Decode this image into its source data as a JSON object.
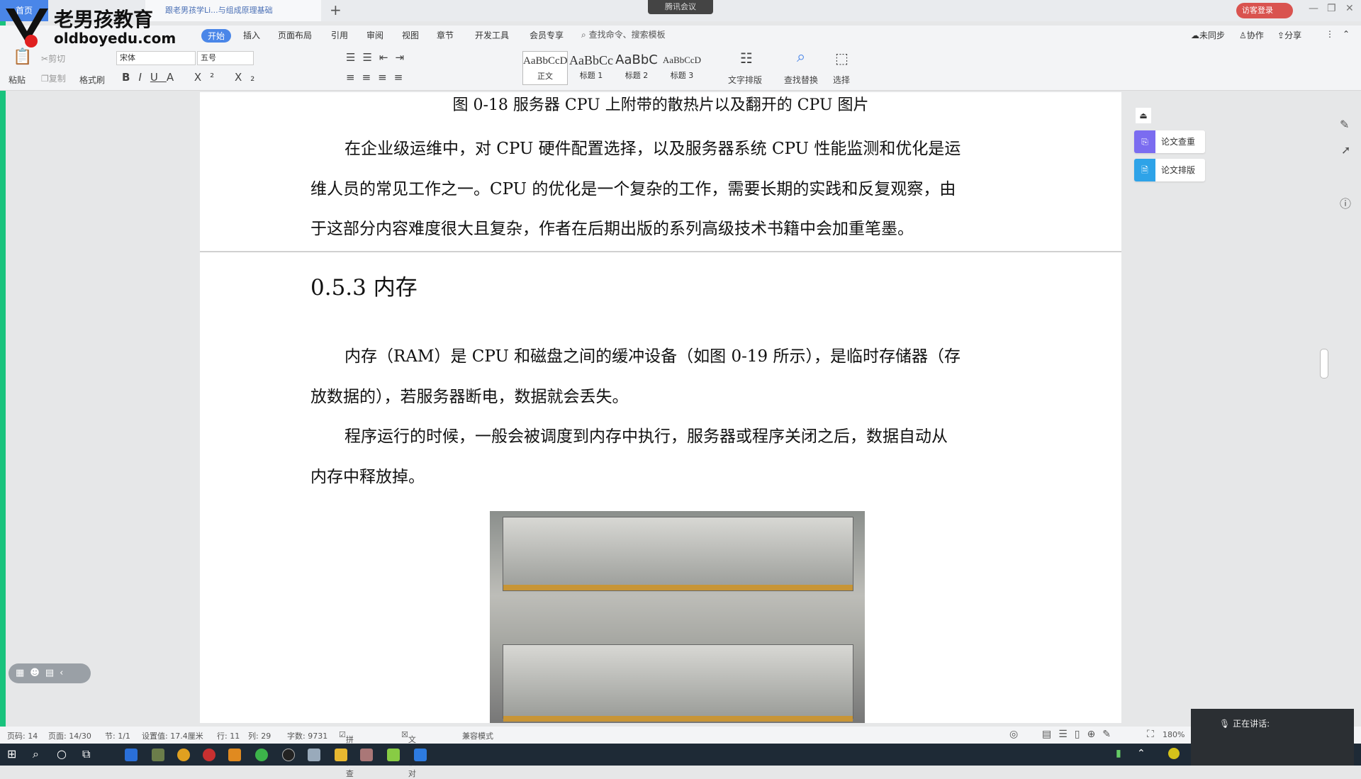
{
  "titlebar": {
    "home_tab": "首页",
    "doc_tab": "跟老男孩学Li...与组成原理基础",
    "meeting": "腾讯会议",
    "login": "访客登录",
    "new_tab": "+"
  },
  "logo": {
    "name": "老男孩教育",
    "url": "oldboyedu.com"
  },
  "menu": {
    "items": [
      "开始",
      "插入",
      "页面布局",
      "引用",
      "审阅",
      "视图",
      "章节",
      "开发工具",
      "会员专享"
    ],
    "search": "查找命令、搜索模板",
    "sync": "未同步",
    "collab": "协作",
    "share": "分享"
  },
  "toolbar": {
    "paste": "粘贴",
    "cut": "剪切",
    "copy": "复制",
    "format_painter": "格式刷",
    "font": "宋体",
    "size": "五号",
    "styles": [
      {
        "sample": "AaBbCcDd",
        "label": "正文"
      },
      {
        "sample": "AaBbCc",
        "label": "标题 1"
      },
      {
        "sample": "AaBbC",
        "label": "标题 2"
      },
      {
        "sample": "AaBbCcD",
        "label": "标题 3"
      }
    ],
    "text_layout": "文字排版",
    "find_replace": "查找替换",
    "select": "选择"
  },
  "document": {
    "caption": "图 0-18  服务器 CPU 上附带的散热片以及翻开的 CPU 图片",
    "para1": [
      "在企业级运维中，对 CPU 硬件配置选择，以及服务器系统 CPU 性能监测和优化是运",
      "维人员的常见工作之一。CPU 的优化是一个复杂的工作，需要长期的实践和反复观察，由",
      "于这部分内容难度很大且复杂，作者在后期出版的系列高级技术书籍中会加重笔墨。"
    ],
    "heading": "0.5.3  内存",
    "para2": [
      "内存（RAM）是 CPU 和磁盘之间的缓冲设备（如图 0-19 所示），是临时存储器（存",
      "放数据的），若服务器断电，数据就会丢失。"
    ],
    "para3": [
      "程序运行的时候，一般会被调度到内存中执行，服务器或程序关闭之后，数据自动从",
      "内存中释放掉。"
    ]
  },
  "side_panel": {
    "check": "论文查重",
    "layout": "论文排版"
  },
  "status": {
    "page_no": "页码: 14",
    "pages": "页面: 14/30",
    "section": "节: 1/1",
    "setting": "设置值: 17.4厘米",
    "row": "行: 11",
    "col": "列: 29",
    "words": "字数: 9731",
    "spell": "拼写检查",
    "proof": "文档校对",
    "compat": "兼容模式",
    "zoom": "180%"
  },
  "meeting_overlay": {
    "speaking": "正在讲话:"
  },
  "colors": {
    "accent": "#4a86e8",
    "login": "#d9534f",
    "check": "#7b6cf0",
    "layout": "#2ea3e8"
  }
}
